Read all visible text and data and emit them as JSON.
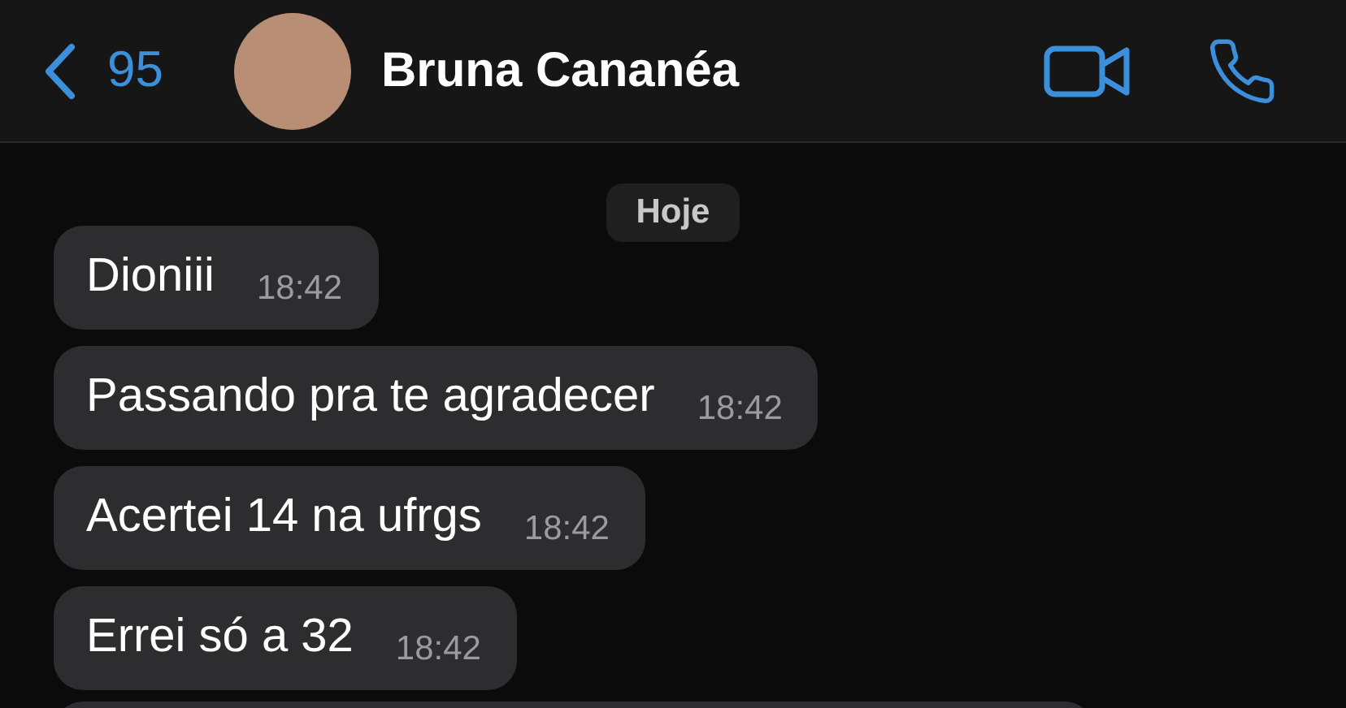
{
  "header": {
    "back_count": "95",
    "contact_name": "Bruna Cananéa"
  },
  "date_label": "Hoje",
  "messages": [
    {
      "text": "Dioniii",
      "time": "18:42"
    },
    {
      "text": "Passando pra te agradecer",
      "time": "18:42"
    },
    {
      "text": "Acertei 14 na ufrgs",
      "time": "18:42"
    },
    {
      "text": "Errei só a 32",
      "time": "18:42"
    }
  ]
}
